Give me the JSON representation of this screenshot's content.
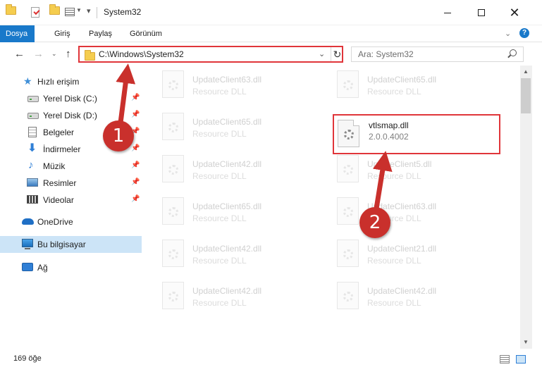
{
  "window": {
    "title": "System32",
    "minimize_icon": "minimize-icon",
    "maximize_icon": "maximize-icon",
    "close_glyph": "✕"
  },
  "ribbon": {
    "tabs": [
      {
        "label": "Dosya",
        "active": true
      },
      {
        "label": "Giriş",
        "active": false
      },
      {
        "label": "Paylaş",
        "active": false
      },
      {
        "label": "Görünüm",
        "active": false
      }
    ],
    "help_glyph": "?"
  },
  "nav": {
    "address": "C:\\Windows\\System32",
    "search_placeholder": "Ara: System32"
  },
  "sidebar": {
    "items": [
      {
        "label": "Hızlı erişim",
        "icon": "star-icon"
      },
      {
        "label": "Yerel Disk (C:)",
        "icon": "disk-icon",
        "pinned": true
      },
      {
        "label": "Yerel Disk (D:)",
        "icon": "disk-icon",
        "pinned": true
      },
      {
        "label": "Belgeler",
        "icon": "document-icon",
        "pinned": true
      },
      {
        "label": "İndirmeler",
        "icon": "download-icon",
        "pinned": true
      },
      {
        "label": "Müzik",
        "icon": "music-icon",
        "pinned": true
      },
      {
        "label": "Resimler",
        "icon": "pictures-icon",
        "pinned": true
      },
      {
        "label": "Videolar",
        "icon": "videos-icon",
        "pinned": true
      },
      {
        "label": "OneDrive",
        "icon": "onedrive-icon"
      },
      {
        "label": "Bu bilgisayar",
        "icon": "computer-icon",
        "selected": true
      },
      {
        "label": "Ağ",
        "icon": "network-icon"
      }
    ]
  },
  "files": {
    "left": [
      {
        "name": "UpdateClient63.dll",
        "sub": "Resource DLL"
      },
      {
        "name": "UpdateClient65.dll",
        "sub": "Resource DLL"
      },
      {
        "name": "UpdateClient42.dll",
        "sub": "Resource DLL"
      },
      {
        "name": "UpdateClient65.dll",
        "sub": "Resource DLL"
      },
      {
        "name": "UpdateClient42.dll",
        "sub": "Resource DLL"
      },
      {
        "name": "UpdateClient42.dll",
        "sub": "Resource DLL"
      }
    ],
    "right": [
      {
        "name": "UpdateClient65.dll",
        "sub": "Resource DLL"
      },
      {
        "name": "UpdateClient5.dll",
        "sub": "Resource DLL"
      },
      {
        "name": "UpdateClient63.dll",
        "sub": "Resource DLL"
      },
      {
        "name": "UpdateClient21.dll",
        "sub": "Resource DLL"
      },
      {
        "name": "UpdateClient42.dll",
        "sub": "Resource DLL"
      }
    ],
    "highlighted": {
      "name": "vtlsmap.dll",
      "sub": "2.0.0.4002"
    }
  },
  "status": {
    "item_count": "169 öğe"
  },
  "annotations": {
    "badge1": "1",
    "badge2": "2",
    "color": "#c9302c"
  }
}
